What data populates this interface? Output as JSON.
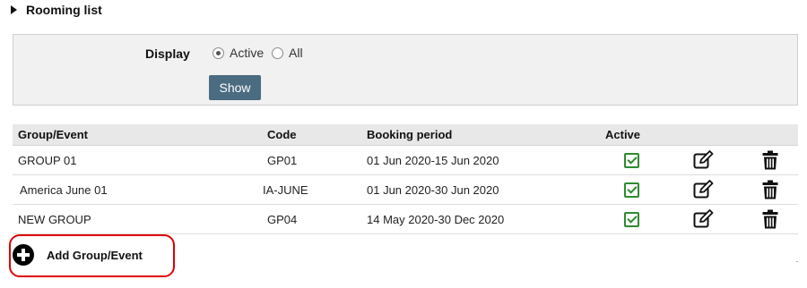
{
  "section": {
    "title": "Rooming list"
  },
  "filter": {
    "display_label": "Display",
    "options": [
      {
        "label": "Active",
        "checked": true
      },
      {
        "label": "All",
        "checked": false
      }
    ],
    "show_label": "Show"
  },
  "table": {
    "headers": {
      "group": "Group/Event",
      "code": "Code",
      "period": "Booking period",
      "active": "Active"
    },
    "rows": [
      {
        "group": "GROUP 01",
        "code": "GP01",
        "period": "01 Jun 2020-15 Jun 2020",
        "active": true
      },
      {
        "group": "America June 01",
        "code": "IA-JUNE",
        "period": "01 Jun 2020-30 Jun 2020",
        "active": true
      },
      {
        "group": "NEW GROUP",
        "code": "GP04",
        "period": "14 May 2020-30 Dec 2020",
        "active": true
      }
    ]
  },
  "add": {
    "label": "Add Group/Event"
  },
  "colors": {
    "show_button": "#4a6b80",
    "check": "#2e8b2e",
    "highlight": "#e00000"
  },
  "icons": {
    "collapse": "triangle-right-icon",
    "active": "checkbox-checked-icon",
    "edit": "edit-icon",
    "delete": "trash-icon",
    "add": "plus-circle-icon"
  }
}
